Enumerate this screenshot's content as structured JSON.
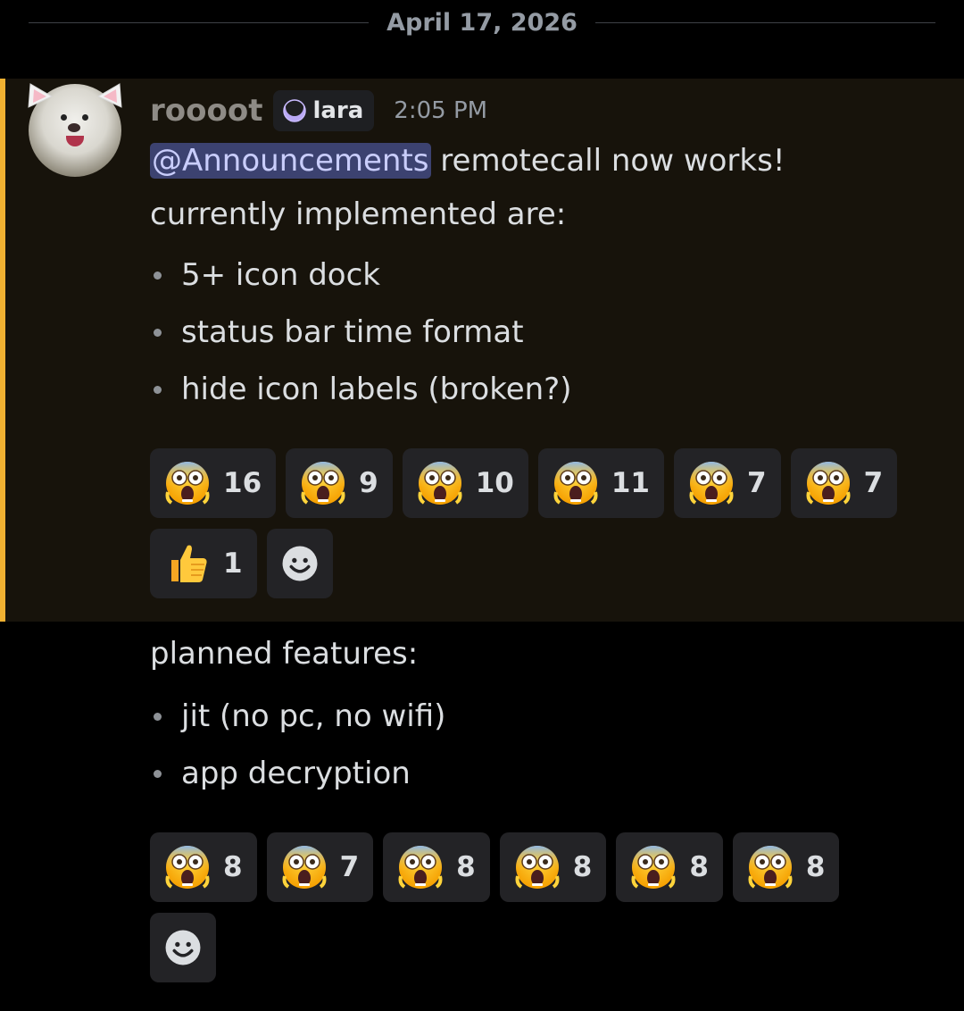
{
  "divider": {
    "date": "April 17, 2026"
  },
  "message": {
    "username": "roooot",
    "tag": {
      "label": "lara",
      "icon": "moon-crescent-icon"
    },
    "timestamp": "2:05 PM",
    "mention": "@Announcements",
    "line1_rest": " remotecall now works!",
    "line2": "currently implemented are:",
    "implemented": [
      "5+ icon dock",
      "status bar time format",
      "hide icon labels (broken?)"
    ],
    "reactions_1": [
      {
        "emoji": "screaming-face",
        "count": "16"
      },
      {
        "emoji": "screaming-face",
        "count": "9"
      },
      {
        "emoji": "screaming-face",
        "count": "10"
      },
      {
        "emoji": "screaming-face",
        "count": "11"
      },
      {
        "emoji": "screaming-face",
        "count": "7"
      },
      {
        "emoji": "screaming-face",
        "count": "7"
      }
    ],
    "reactions_1b": [
      {
        "emoji": "thumbs-up",
        "count": "1"
      }
    ]
  },
  "followup": {
    "heading": "planned features:",
    "planned": [
      "jit (no pc, no wifi)",
      "app decryption"
    ],
    "reactions": [
      {
        "emoji": "screaming-face",
        "count": "8"
      },
      {
        "emoji": "screaming-face",
        "count": "7"
      },
      {
        "emoji": "screaming-face",
        "count": "8"
      },
      {
        "emoji": "screaming-face",
        "count": "8"
      },
      {
        "emoji": "screaming-face",
        "count": "8"
      },
      {
        "emoji": "screaming-face",
        "count": "8"
      }
    ]
  },
  "colors": {
    "mention_highlight": "#17130b",
    "mention_bar": "#f0b132",
    "mention_pill": "#3c4270",
    "reaction_bg": "#232326"
  }
}
